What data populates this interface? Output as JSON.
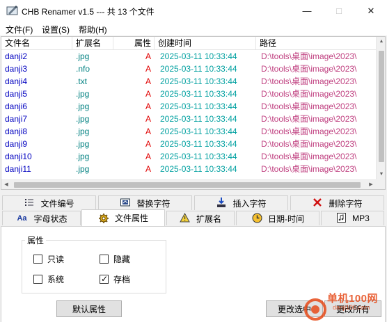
{
  "window": {
    "title": "CHB Renamer v1.5 --- 共 13 个文件",
    "min_glyph": "—",
    "max_glyph": "□",
    "close_glyph": "✕"
  },
  "menu": [
    {
      "label": "文件(F)"
    },
    {
      "label": "设置(S)"
    },
    {
      "label": "帮助(H)"
    }
  ],
  "file_list": {
    "columns": [
      "文件名",
      "扩展名",
      "属性",
      "创建时间",
      "路径"
    ],
    "rows": [
      {
        "name": "danji2",
        "ext": ".jpg",
        "attr": "A",
        "date": "2025-03-11 10:33:44",
        "path": "D:\\tools\\桌面\\image\\2023\\"
      },
      {
        "name": "danji3",
        "ext": ".nfo",
        "attr": "A",
        "date": "2025-03-11 10:33:44",
        "path": "D:\\tools\\桌面\\image\\2023\\"
      },
      {
        "name": "danji4",
        "ext": ".txt",
        "attr": "A",
        "date": "2025-03-11 10:33:44",
        "path": "D:\\tools\\桌面\\image\\2023\\"
      },
      {
        "name": "danji5",
        "ext": ".jpg",
        "attr": "A",
        "date": "2025-03-11 10:33:44",
        "path": "D:\\tools\\桌面\\image\\2023\\"
      },
      {
        "name": "danji6",
        "ext": ".jpg",
        "attr": "A",
        "date": "2025-03-11 10:33:44",
        "path": "D:\\tools\\桌面\\image\\2023\\"
      },
      {
        "name": "danji7",
        "ext": ".jpg",
        "attr": "A",
        "date": "2025-03-11 10:33:44",
        "path": "D:\\tools\\桌面\\image\\2023\\"
      },
      {
        "name": "danji8",
        "ext": ".jpg",
        "attr": "A",
        "date": "2025-03-11 10:33:44",
        "path": "D:\\tools\\桌面\\image\\2023\\"
      },
      {
        "name": "danji9",
        "ext": ".jpg",
        "attr": "A",
        "date": "2025-03-11 10:33:44",
        "path": "D:\\tools\\桌面\\image\\2023\\"
      },
      {
        "name": "danji10",
        "ext": ".jpg",
        "attr": "A",
        "date": "2025-03-11 10:33:44",
        "path": "D:\\tools\\桌面\\image\\2023\\"
      },
      {
        "name": "danji11",
        "ext": ".jpg",
        "attr": "A",
        "date": "2025-03-11 10:33:44",
        "path": "D:\\tools\\桌面\\image\\2023\\"
      }
    ]
  },
  "tabs_row1": [
    {
      "label": "文件编号",
      "icon": "list-numbered-icon"
    },
    {
      "label": "替换字符",
      "icon": "replace-icon"
    },
    {
      "label": "插入字符",
      "icon": "insert-icon"
    },
    {
      "label": "删除字符",
      "icon": "delete-x-icon"
    }
  ],
  "tabs_row2": [
    {
      "label": "字母状态",
      "icon": "letter-case-icon"
    },
    {
      "label": "文件属性",
      "icon": "gear-icon",
      "active": true
    },
    {
      "label": "扩展名",
      "icon": "warning-icon"
    },
    {
      "label": "日期-时间",
      "icon": "clock-icon"
    },
    {
      "label": "MP3",
      "icon": "music-icon"
    }
  ],
  "attributes": {
    "group_label": "属性",
    "readonly": {
      "label": "只读",
      "checked": false
    },
    "hidden": {
      "label": "隐藏",
      "checked": false
    },
    "system": {
      "label": "系统",
      "checked": false
    },
    "archive": {
      "label": "存档",
      "checked": true
    }
  },
  "buttons": {
    "default_attr": "默认属性",
    "modify_selected": "更改选中",
    "modify_all": "更改所有"
  },
  "watermark": {
    "text": "单机100网",
    "sub": "danji100.com"
  },
  "colors": {
    "name": "#0000c0",
    "ext": "#008080",
    "attr": "#e00000",
    "date": "#00a0a0",
    "path": "#c04080",
    "watermark": "#e64a19"
  }
}
